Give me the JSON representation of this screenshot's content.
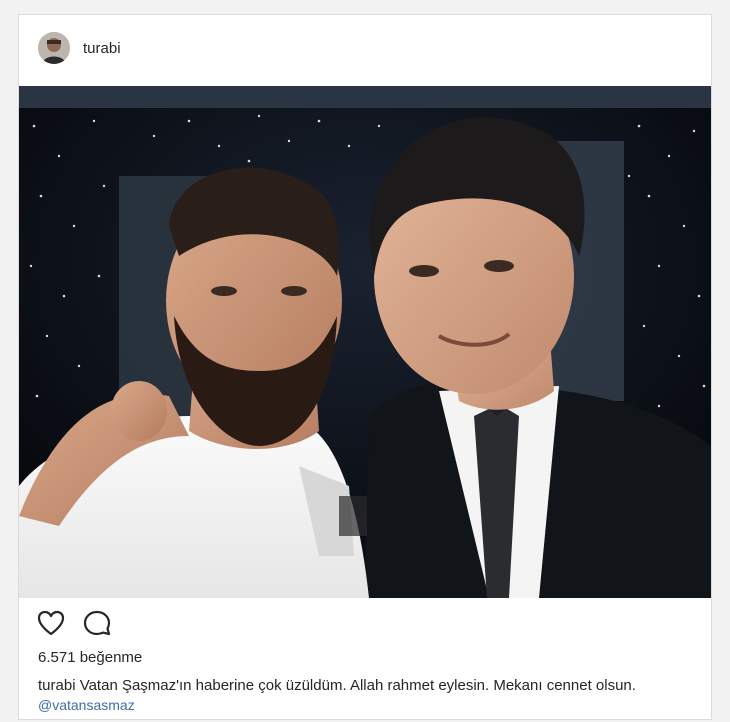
{
  "post": {
    "username": "turabi",
    "likes_text": "6.571 beğenme",
    "caption_user": "turabi",
    "caption_text": "Vatan Şaşmaz'ın haberine çok üzüldüm. Allah rahmet eylesin. Mekanı cennet olsun.",
    "mention": "@vatansasmaz"
  },
  "icons": {
    "like": "heart-icon",
    "comment": "comment-icon"
  },
  "colors": {
    "text": "#262626",
    "mention": "#3b6ea8",
    "border": "#dbdbdb"
  }
}
